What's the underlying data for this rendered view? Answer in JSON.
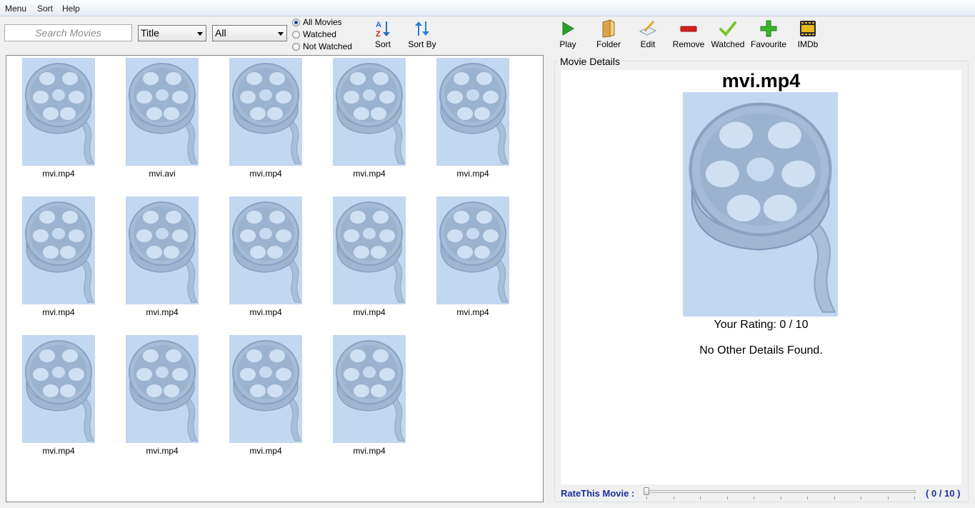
{
  "menu": [
    "Menu",
    "Sort",
    "Help"
  ],
  "search": {
    "placeholder": "Search Movies"
  },
  "filters": {
    "sort_field": "Title",
    "category": "All",
    "view_options": [
      {
        "label": "All Movies",
        "checked": true
      },
      {
        "label": "Watched",
        "checked": false
      },
      {
        "label": "Not Watched",
        "checked": false
      }
    ]
  },
  "toolbar": {
    "sort": "Sort",
    "sort_by": "Sort By",
    "play": "Play",
    "folder": "Folder",
    "edit": "Edit",
    "remove": "Remove",
    "watched": "Watched",
    "favourite": "Favourite",
    "imdb": "IMDb"
  },
  "movies": [
    "mvi.mp4",
    "mvi.avi",
    "mvi.mp4",
    "mvi.mp4",
    "mvi.mp4",
    "mvi.mp4",
    "mvi.mp4",
    "mvi.mp4",
    "mvi.mp4",
    "mvi.mp4",
    "mvi.mp4",
    "mvi.mp4",
    "mvi.mp4",
    "mvi.mp4"
  ],
  "details": {
    "group_title": "Movie Details",
    "title": "mvi.mp4",
    "rating": "Your Rating: 0 / 10",
    "other": "No Other Details Found.",
    "rate_label": "RateThis Movie :",
    "rate_value": "( 0 / 10 )",
    "rating_value": 0,
    "rating_max": 10
  },
  "colors": {
    "accent_text": "#1a2fa0",
    "poster_bg": "#bcd3ee"
  }
}
